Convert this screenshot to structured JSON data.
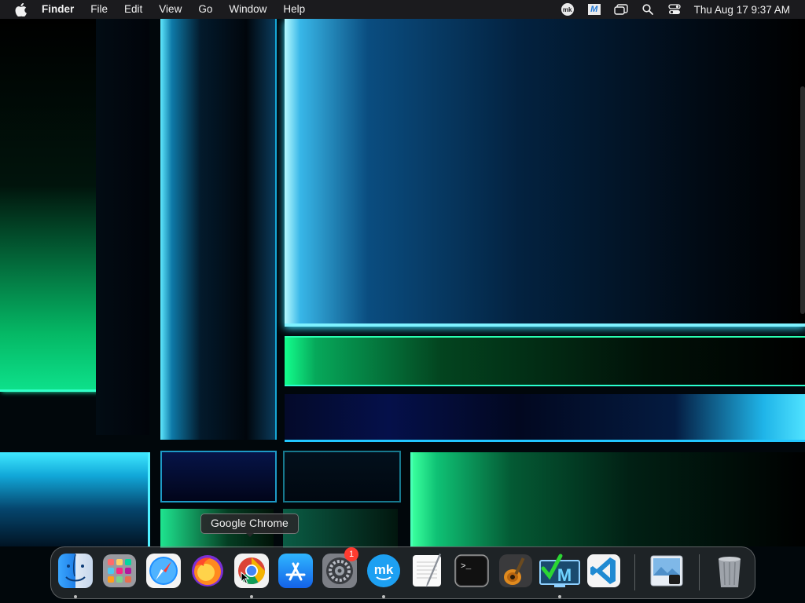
{
  "menubar": {
    "app_name": "Finder",
    "menus": [
      "File",
      "Edit",
      "View",
      "Go",
      "Window",
      "Help"
    ],
    "status_icons": [
      "mk-icon",
      "m-app-icon",
      "window-switcher-icon",
      "spotlight-search-icon",
      "control-center-icon"
    ],
    "tray_mk_text": "mk",
    "tray_m_text": "M",
    "clock": "Thu Aug 17  9:37 AM"
  },
  "dock": {
    "tooltip": "Google Chrome",
    "apps": [
      {
        "name": "Finder",
        "icon": "finder-icon",
        "running": true
      },
      {
        "name": "Launchpad",
        "icon": "launchpad-icon",
        "running": false
      },
      {
        "name": "Safari",
        "icon": "safari-icon",
        "running": false
      },
      {
        "name": "Firefox",
        "icon": "firefox-icon",
        "running": false
      },
      {
        "name": "Google Chrome",
        "icon": "chrome-icon",
        "running": true
      },
      {
        "name": "App Store",
        "icon": "app-store-icon",
        "running": false
      },
      {
        "name": "System Settings",
        "icon": "system-settings-icon",
        "running": false,
        "badge": "1"
      },
      {
        "name": "MK",
        "icon": "mk-app-icon",
        "running": true,
        "text": "mk"
      },
      {
        "name": "TextEdit",
        "icon": "textedit-icon",
        "running": false
      },
      {
        "name": "Terminal",
        "icon": "terminal-icon",
        "running": false,
        "text": ">_"
      },
      {
        "name": "GarageBand",
        "icon": "garageband-icon",
        "running": false
      },
      {
        "name": "M Monitor",
        "icon": "m-monitor-icon",
        "running": true,
        "text": "M"
      },
      {
        "name": "Visual Studio Code",
        "icon": "vscode-icon",
        "running": false
      },
      {
        "name": "Preview",
        "icon": "preview-icon",
        "running": false
      },
      {
        "name": "Trash",
        "icon": "trash-icon",
        "running": false
      }
    ]
  },
  "colors": {
    "menubar_bg": "#1b1b1e",
    "badge": "#ff3b30",
    "wallpaper_accent_cyan": "#3fe8ff",
    "wallpaper_accent_green": "#13ff8d"
  }
}
